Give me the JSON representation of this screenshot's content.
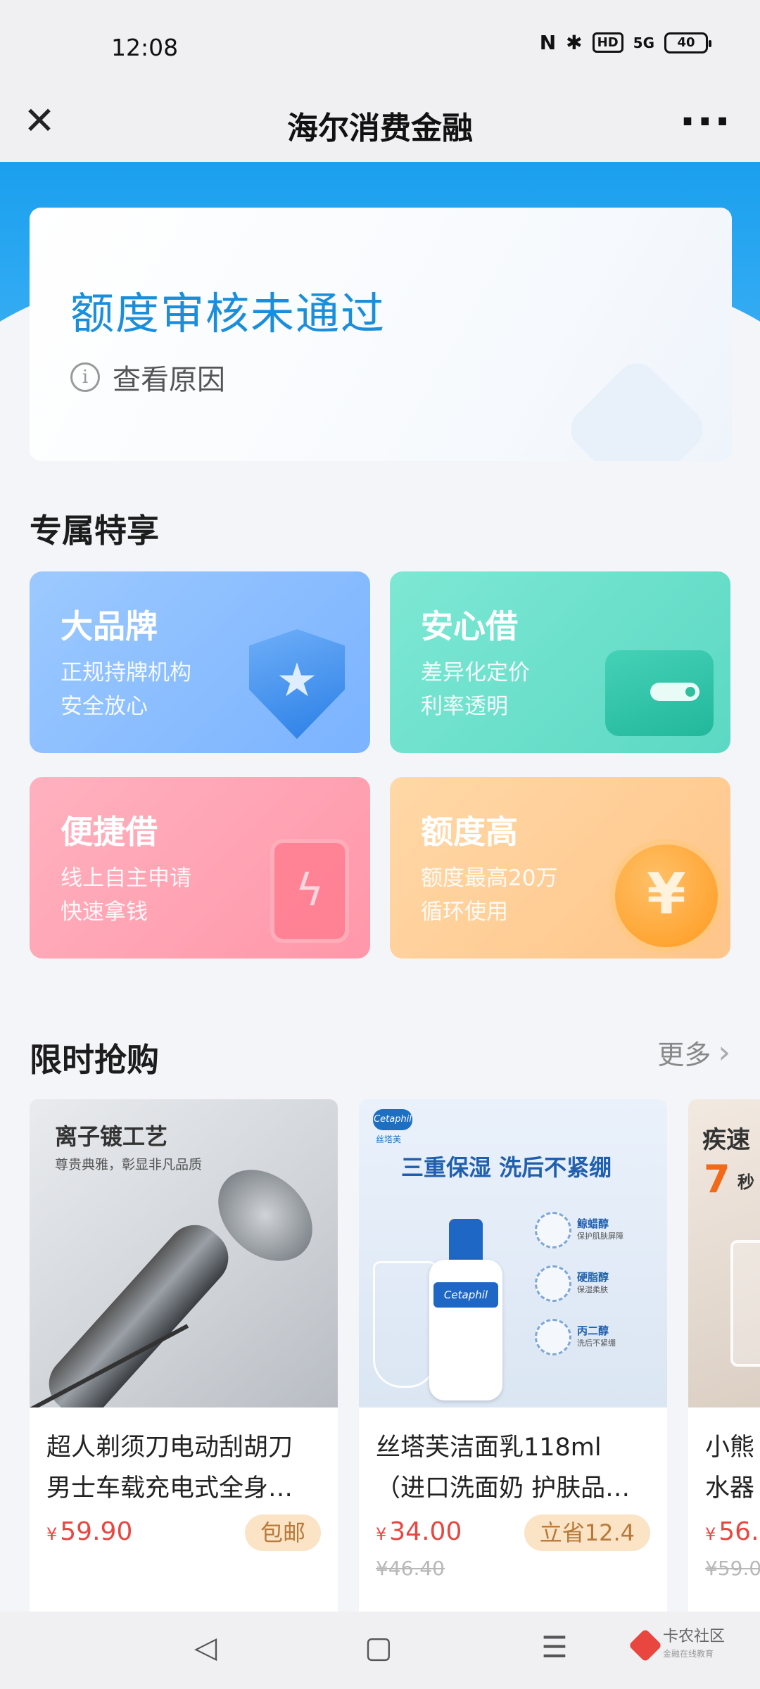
{
  "status_bar": {
    "time": "12:08",
    "nfc": "N",
    "bluetooth": "✱",
    "hd": "HD",
    "signal": "5G",
    "battery": "40"
  },
  "nav": {
    "title": "海尔消费金融",
    "close_icon": "close-icon",
    "more_icon": "more-icon"
  },
  "status_card": {
    "headline": "额度审核未通过",
    "reason_link": "查看原因"
  },
  "exclusive": {
    "title": "专属特享",
    "features": [
      {
        "title": "大品牌",
        "line1": "正规持牌机构",
        "line2": "安全放心",
        "icon": "shield-star-icon"
      },
      {
        "title": "安心借",
        "line1": "差异化定价",
        "line2": "利率透明",
        "icon": "wallet-icon"
      },
      {
        "title": "便捷借",
        "line1": "线上自主申请",
        "line2": "快速拿钱",
        "icon": "phone-bolt-icon"
      },
      {
        "title": "额度高",
        "line1": "额度最高20万",
        "line2": "循环使用",
        "icon": "yen-coin-icon"
      }
    ]
  },
  "flash_sale": {
    "title": "限时抢购",
    "more_label": "更多",
    "products": [
      {
        "image_headline": "离子镀工艺",
        "image_sub": "尊贵典雅，彰显非凡品质",
        "name_line1": "超人剃须刀电动刮胡刀",
        "name_line2": "男士车载充电式全身…",
        "currency": "¥",
        "price": "59.90",
        "badge": "包邮"
      },
      {
        "image_logo": "Cetaphil",
        "image_logo_sub": "丝塔芙",
        "image_headline": "三重保湿  洗后不紧绷",
        "bottle_label": "Cetaphil",
        "ingredients": [
          {
            "name": "鲸蜡醇",
            "desc": "保护肌肤屏障"
          },
          {
            "name": "硬脂醇",
            "desc": "保湿柔肤"
          },
          {
            "name": "丙二醇",
            "desc": "洗后不紧绷"
          }
        ],
        "name_line1": "丝塔芙洁面乳118ml",
        "name_line2": "（进口洗面奶 护肤品…",
        "currency": "¥",
        "price": "34.00",
        "original_price": "¥46.40",
        "badge": "立省12.4"
      },
      {
        "image_headline": "疾速",
        "image_num": "7",
        "image_unit": "秒",
        "name_line1": "小熊",
        "name_line2": "水器",
        "currency": "¥",
        "price": "56.",
        "original_price": "¥59.0"
      }
    ]
  },
  "bottom_nav": {
    "back": "◁",
    "home": "▢",
    "menu": "☰"
  },
  "watermark": {
    "name": "卡农社区",
    "sub": "金融在线教育"
  },
  "colors": {
    "brand_blue": "#1b8edb",
    "price_red": "#e8463f",
    "badge_bg": "#fbe3c6"
  }
}
